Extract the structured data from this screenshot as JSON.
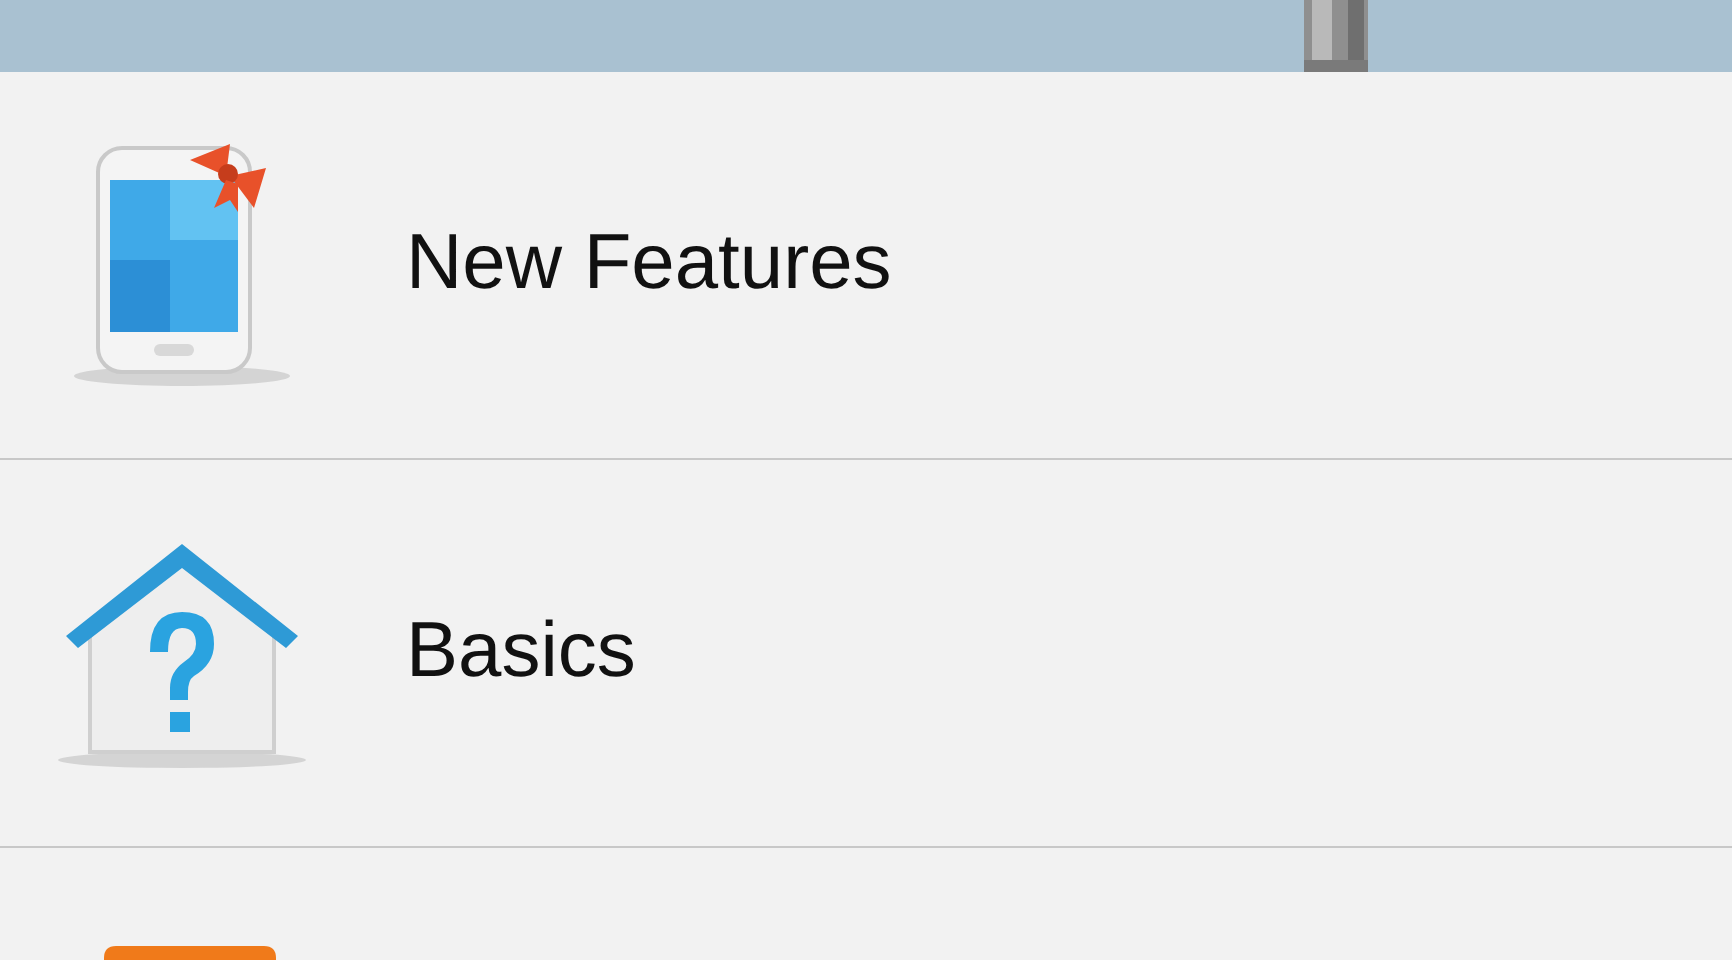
{
  "items": [
    {
      "kind": "phone",
      "label": "New Features"
    },
    {
      "kind": "house",
      "label": "Basics"
    },
    {
      "kind": "orange"
    }
  ]
}
